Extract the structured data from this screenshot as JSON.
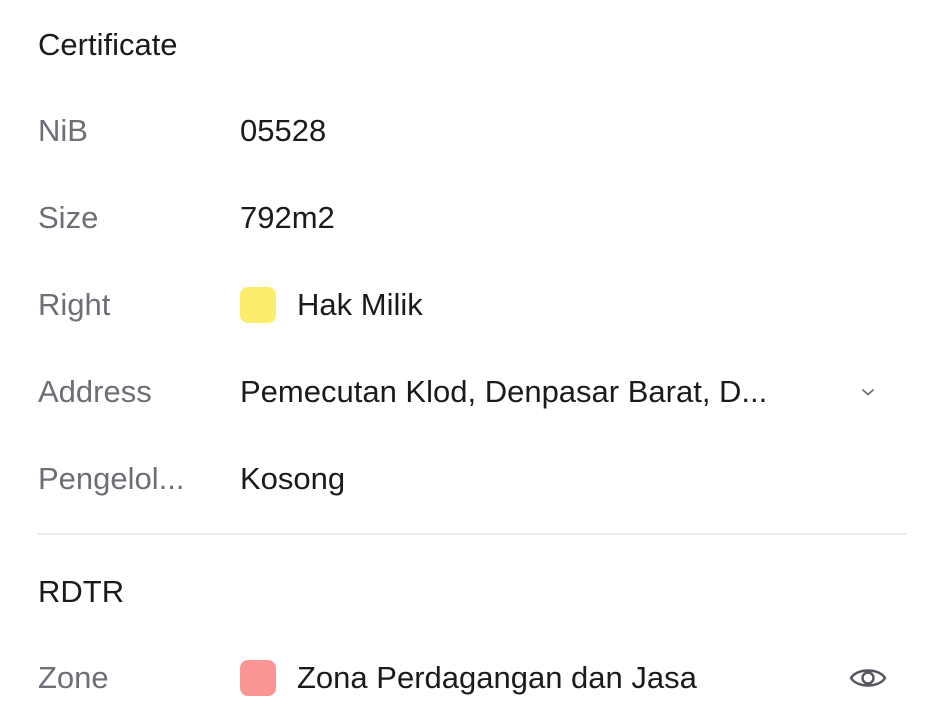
{
  "certificate": {
    "title": "Certificate",
    "rows": [
      {
        "label": "NiB",
        "value": "05528"
      },
      {
        "label": "Size",
        "value": "792m2"
      },
      {
        "label": "Right",
        "value": "Hak Milik",
        "swatch_color": "#fcec6b"
      },
      {
        "label": "Address",
        "value": "Pemecutan Klod, Denpasar Barat, D...",
        "icon": "chevron-down-icon"
      },
      {
        "label": "Pengelol...",
        "value": "Kosong"
      }
    ]
  },
  "rdtr": {
    "title": "RDTR",
    "rows": [
      {
        "label": "Zone",
        "value": "Zona Perdagangan dan Jasa",
        "swatch_color": "#fa9696",
        "icon": "eye-icon"
      }
    ]
  }
}
